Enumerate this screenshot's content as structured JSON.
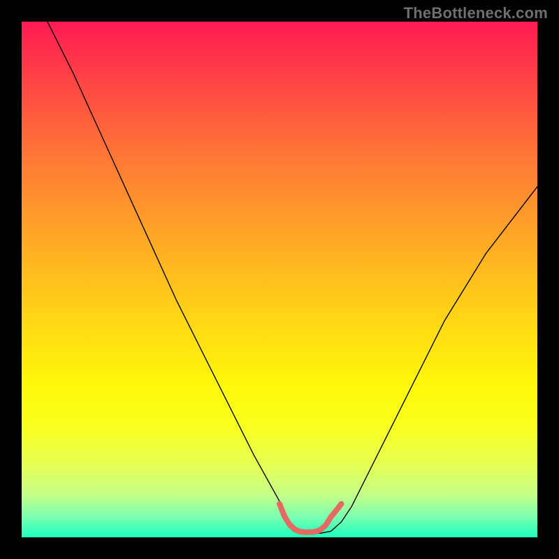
{
  "watermark": {
    "text": "TheBottleneck.com"
  },
  "chart_data": {
    "type": "line",
    "title": "",
    "xlabel": "",
    "ylabel": "",
    "xlim": [
      0,
      100
    ],
    "ylim": [
      0,
      100
    ],
    "annotations": [],
    "series": [
      {
        "name": "black-curve",
        "color": "#000000",
        "width": 1.4,
        "x": [
          5,
          10,
          15,
          20,
          25,
          30,
          35,
          40,
          45,
          50,
          52,
          54,
          56,
          58,
          60,
          62,
          64,
          68,
          74,
          82,
          90,
          100
        ],
        "y": [
          100,
          90,
          79,
          68,
          57,
          46,
          36,
          26,
          16,
          7,
          3,
          1.2,
          0.8,
          0.8,
          1.2,
          3,
          6,
          14,
          26,
          42,
          55,
          68
        ]
      },
      {
        "name": "red-flat-segment",
        "color": "#e46a63",
        "width": 8,
        "x": [
          50,
          51,
          52,
          53,
          54,
          55,
          56,
          57,
          58,
          59,
          60,
          61,
          62
        ],
        "y": [
          6.5,
          4.0,
          2.4,
          1.5,
          1.1,
          1.0,
          1.0,
          1.1,
          1.5,
          2.4,
          4.0,
          5.2,
          6.5
        ]
      }
    ]
  }
}
